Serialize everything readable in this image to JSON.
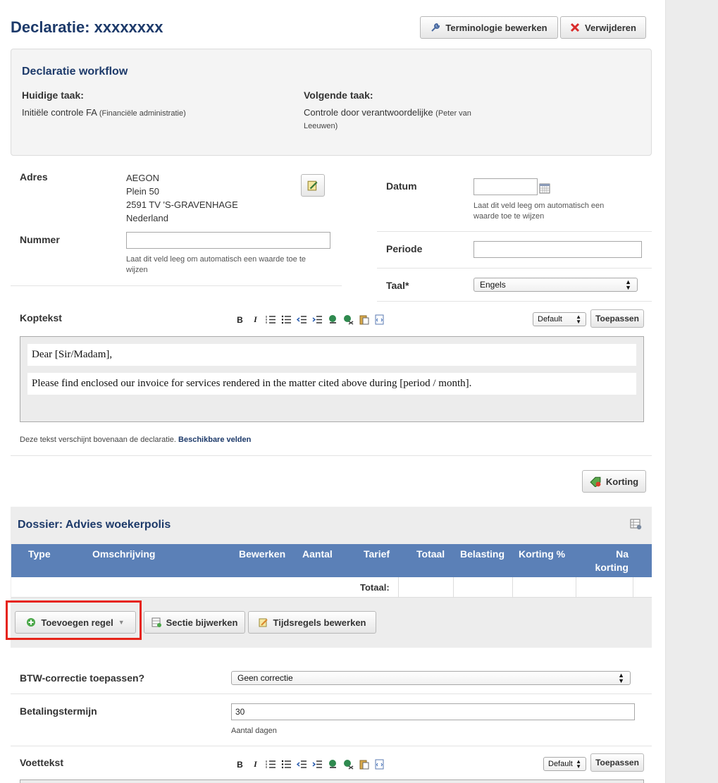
{
  "page": {
    "title": "Declaratie: xxxxxxxx"
  },
  "header_buttons": {
    "terminology": "Terminologie bewerken",
    "delete": "Verwijderen"
  },
  "workflow": {
    "title": "Declaratie workflow",
    "current_label": "Huidige taak:",
    "current_value": "Initiële controle FA",
    "current_note": "(Financiële administratie)",
    "next_label": "Volgende taak:",
    "next_value": "Controle door verantwoordelijke",
    "next_note_1": "(Peter van",
    "next_note_2": "Leeuwen)"
  },
  "address": {
    "label": "Adres",
    "lines": [
      "AEGON",
      "Plein 50",
      "2591 TV 'S-GRAVENHAGE",
      "Nederland"
    ]
  },
  "number": {
    "label": "Nummer",
    "value": "",
    "hint_1": "Laat dit veld leeg om automatisch een waarde toe te",
    "hint_2": "wijzen"
  },
  "date": {
    "label": "Datum",
    "value": "",
    "hint_1": "Laat dit veld leeg om automatisch een",
    "hint_2": "waarde toe te wijzen"
  },
  "period": {
    "label": "Periode",
    "value": ""
  },
  "language": {
    "label": "Taal*",
    "selected": "Engels"
  },
  "header_text": {
    "label": "Koptekst",
    "style_select": "Default",
    "apply": "Toepassen",
    "para1": "Dear [Sir/Madam],",
    "para2": "Please find enclosed our invoice for services rendered in the matter cited above during [period / month].",
    "note": "Deze tekst verschijnt bovenaan de declaratie.",
    "note_link": "Beschikbare velden"
  },
  "toolbar_icons": [
    "bold-icon",
    "italic-icon",
    "ordered-list-icon",
    "unordered-list-icon",
    "outdent-icon",
    "indent-icon",
    "link-icon",
    "unlink-icon",
    "paste-icon",
    "source-icon"
  ],
  "toolbar_glyphs": {
    "bold": "B",
    "italic": "I"
  },
  "discount_button": "Korting",
  "dossier": {
    "title": "Dossier: Advies woekerpolis",
    "columns": [
      "Type",
      "Omschrijving",
      "Bewerken",
      "Aantal",
      "Tarief",
      "Totaal",
      "Belasting",
      "Korting %",
      "Na",
      "korting"
    ],
    "total_label": "Totaal:",
    "add_line": "Toevoegen regel",
    "update_section": "Sectie bijwerken",
    "edit_time": "Tijdsregels bewerken"
  },
  "vat": {
    "label": "BTW-correctie toepassen?",
    "selected": "Geen correctie"
  },
  "payment": {
    "label": "Betalingstermijn",
    "value": "30",
    "hint": "Aantal dagen"
  },
  "footer_text": {
    "label": "Voettekst",
    "style_select": "Default",
    "apply": "Toepassen"
  },
  "colors": {
    "title_blue": "#1d3a6a",
    "table_header": "#5b80b7",
    "highlight": "#e62419"
  }
}
